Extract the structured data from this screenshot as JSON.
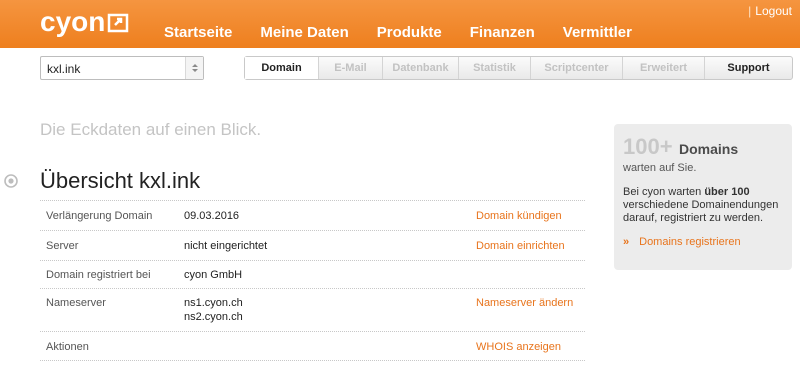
{
  "brand": {
    "logo_text": "cyon",
    "accent": "#ee7f1e"
  },
  "header": {
    "nav": [
      "Startseite",
      "Meine Daten",
      "Produkte",
      "Finanzen",
      "Vermittler"
    ],
    "logout": "Logout"
  },
  "toolbar": {
    "domain_select": "kxl.ink",
    "tabs": [
      {
        "label": "Domain",
        "state": "active"
      },
      {
        "label": "E-Mail",
        "state": "disabled"
      },
      {
        "label": "Datenbank",
        "state": "disabled"
      },
      {
        "label": "Statistik",
        "state": "disabled"
      },
      {
        "label": "Scriptcenter",
        "state": "disabled"
      },
      {
        "label": "Erweitert",
        "state": "disabled"
      },
      {
        "label": "Support",
        "state": "enabled"
      }
    ]
  },
  "main": {
    "tagline": "Die Eckdaten auf einen Blick.",
    "title": "Übersicht kxl.ink",
    "rows": [
      {
        "label": "Verlängerung Domain",
        "value": "09.03.2016",
        "value2": "",
        "action": "Domain kündigen"
      },
      {
        "label": "Server",
        "value": "nicht eingerichtet",
        "value2": "",
        "action": "Domain einrichten"
      },
      {
        "label": "Domain registriert bei",
        "value": "cyon GmbH",
        "value2": "",
        "action": ""
      },
      {
        "label": "Nameserver",
        "value": "ns1.cyon.ch",
        "value2": "ns2.cyon.ch",
        "action": "Nameserver ändern"
      },
      {
        "label": "Aktionen",
        "value": "",
        "value2": "",
        "action": "WHOIS anzeigen"
      }
    ]
  },
  "promo": {
    "big": "100+",
    "domains": "Domains",
    "sub": "warten auf Sie.",
    "text_pre": "Bei cyon warten ",
    "text_bold": "über 100",
    "text_post": " verschiedene Domainendungen darauf, registriert zu werden.",
    "link_icon": "»",
    "link": "Domains registrieren"
  }
}
